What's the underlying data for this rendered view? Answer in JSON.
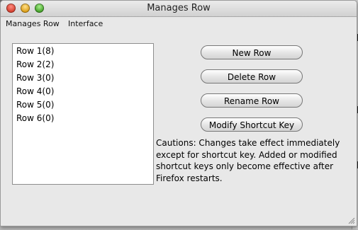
{
  "window": {
    "title": "Manages Row"
  },
  "menubar": {
    "items": [
      "Manages Row",
      "Interface"
    ]
  },
  "rows": [
    "Row 1(8)",
    "Row 2(2)",
    "Row 3(0)",
    "Row 4(0)",
    "Row 5(0)",
    "Row 6(0)"
  ],
  "buttons": {
    "new_row": "New Row",
    "delete_row": "Delete Row",
    "rename_row": "Rename Row",
    "modify_shortcut": "Modify Shortcut Key"
  },
  "caution_text": "Cautions: Changes take effect immediately except for shortcut key. Added or modified shortcut keys only become effective after Firefox restarts.",
  "icons": [
    "close-icon",
    "minimize-icon",
    "zoom-icon",
    "resize-grip-icon"
  ]
}
